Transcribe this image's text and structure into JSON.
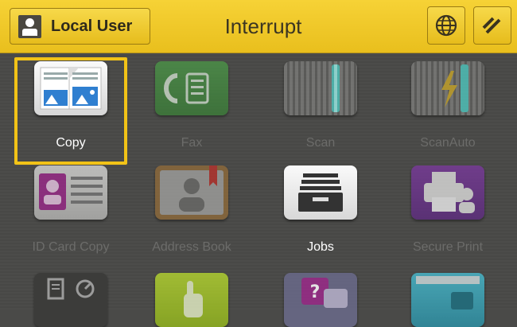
{
  "header": {
    "user_label": "Local User",
    "title": "Interrupt",
    "globe_icon": "globe-icon",
    "slash_icon": "diagonal-lines-icon"
  },
  "tiles": [
    {
      "label": "Copy",
      "icon": "copy-icon",
      "state": "selected"
    },
    {
      "label": "Fax",
      "icon": "fax-icon",
      "state": "disabled"
    },
    {
      "label": "Scan",
      "icon": "scan-icon",
      "state": "disabled"
    },
    {
      "label": "ScanAuto",
      "icon": "scan-auto-icon",
      "state": "disabled"
    },
    {
      "label": "ID Card Copy",
      "icon": "id-card-icon",
      "state": "disabled"
    },
    {
      "label": "Address Book",
      "icon": "address-book-icon",
      "state": "disabled"
    },
    {
      "label": "Jobs",
      "icon": "jobs-icon",
      "state": "enabled"
    },
    {
      "label": "Secure Print",
      "icon": "secure-print-icon",
      "state": "disabled"
    }
  ],
  "colors": {
    "accent": "#f2c317",
    "topbar": "#efca2a"
  }
}
